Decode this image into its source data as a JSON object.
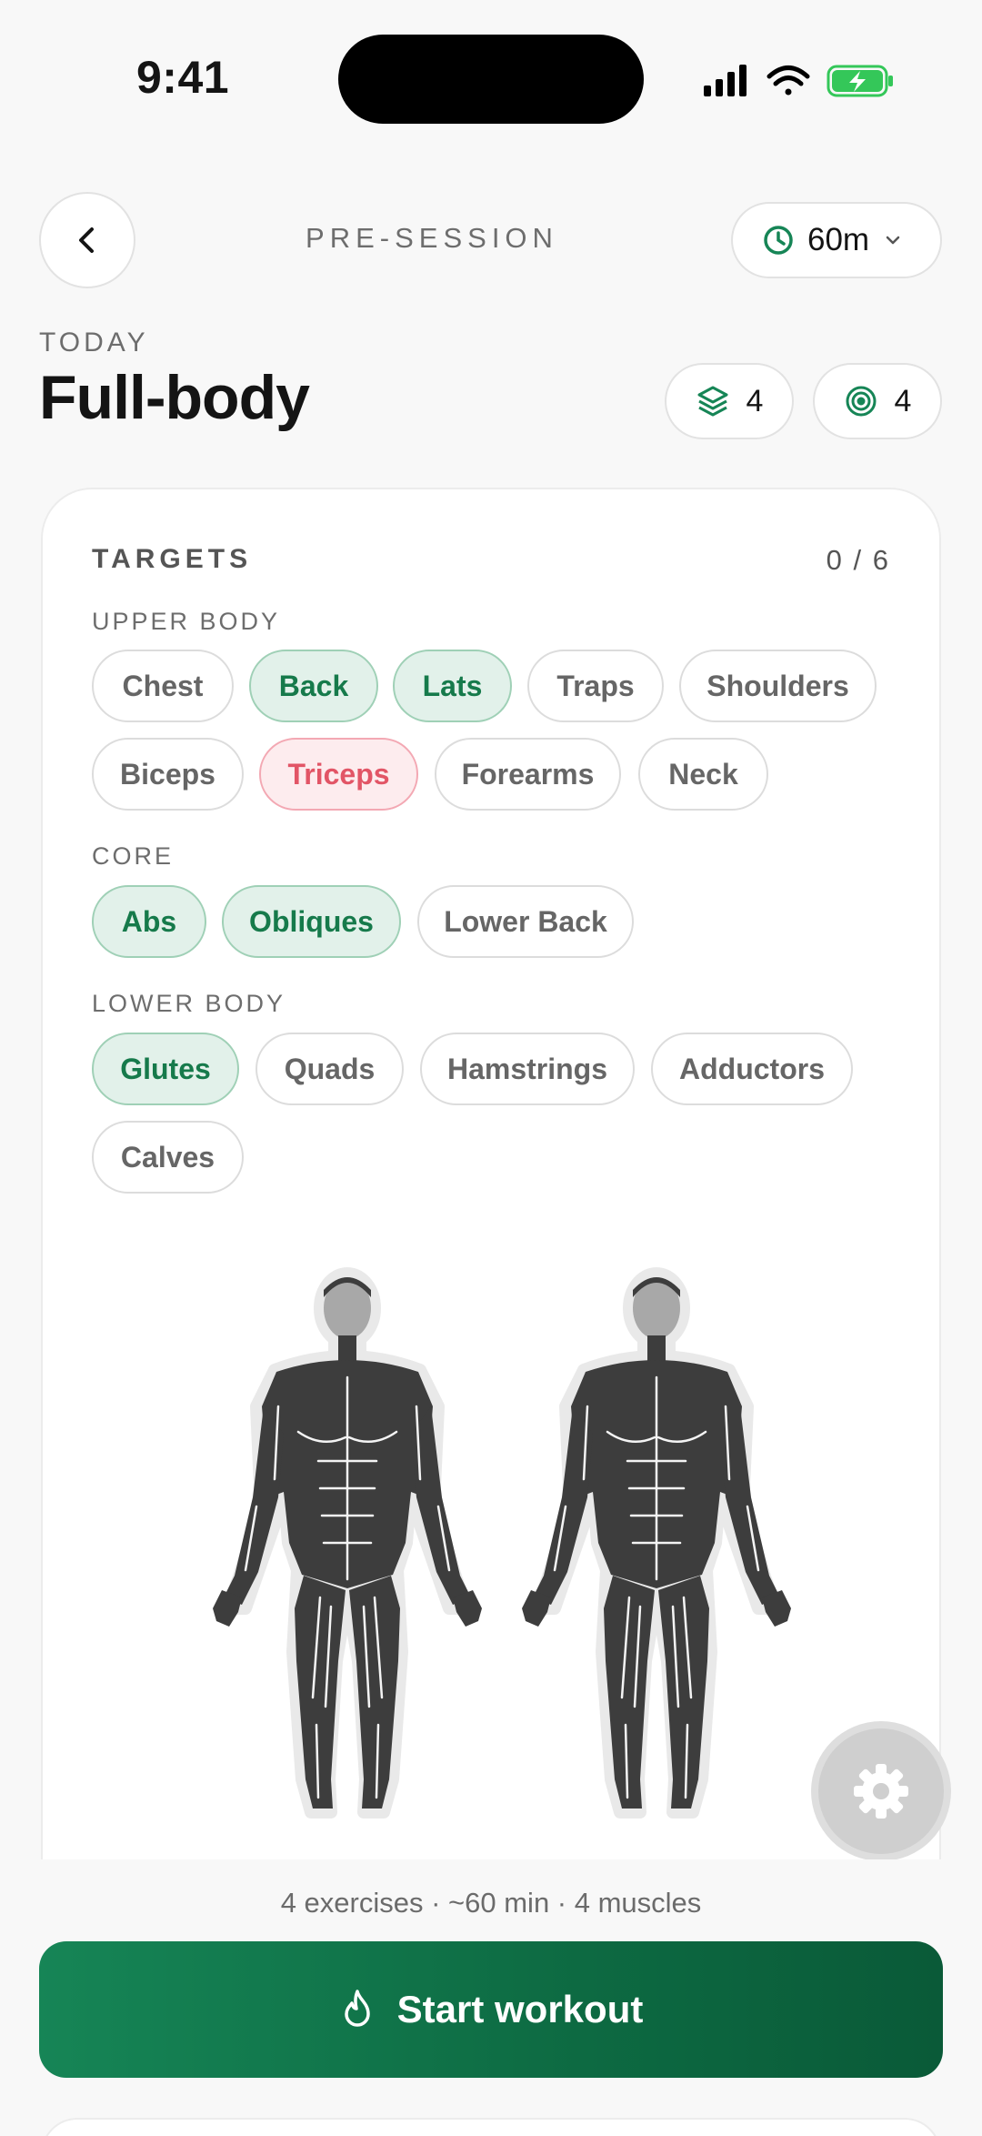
{
  "status_bar": {
    "time": "9:41"
  },
  "header": {
    "title": "PRE-SESSION",
    "duration": "60m"
  },
  "session": {
    "day_label": "TODAY",
    "title": "Full-body",
    "exercises_count": "4",
    "muscles_count": "4"
  },
  "targets": {
    "title": "TARGETS",
    "count": "0 / 6",
    "groups": [
      {
        "label": "UPPER BODY",
        "chips": [
          "Chest",
          "Back",
          "Lats",
          "Traps",
          "Shoulders",
          "Biceps",
          "Triceps",
          "Forearms",
          "Neck"
        ]
      },
      {
        "label": "CORE",
        "chips": [
          "Abs",
          "Obliques",
          "Lower Back"
        ]
      },
      {
        "label": "LOWER BODY",
        "chips": [
          "Glutes",
          "Quads",
          "Hamstrings",
          "Adductors",
          "Calves"
        ]
      }
    ],
    "selected_green": [
      "Back",
      "Lats",
      "Abs",
      "Obliques",
      "Glutes"
    ],
    "selected_red": [
      "Triceps"
    ]
  },
  "footer": {
    "summary": "4 exercises · ~60 min · 4 muscles",
    "start_label": "Start workout"
  },
  "colors": {
    "accent": "#168556",
    "selected_bg": "#e2f1ea",
    "selected_text": "#167a4b",
    "warning_bg": "#fdecee",
    "warning_text": "#e25566",
    "muscle_fill": "#3d3d3d"
  },
  "icons": {
    "back": "chevron-left-icon",
    "duration": "clock-icon",
    "exercises": "layers-icon",
    "muscles": "target-icon",
    "settings": "gear-icon",
    "start": "flame-icon"
  }
}
